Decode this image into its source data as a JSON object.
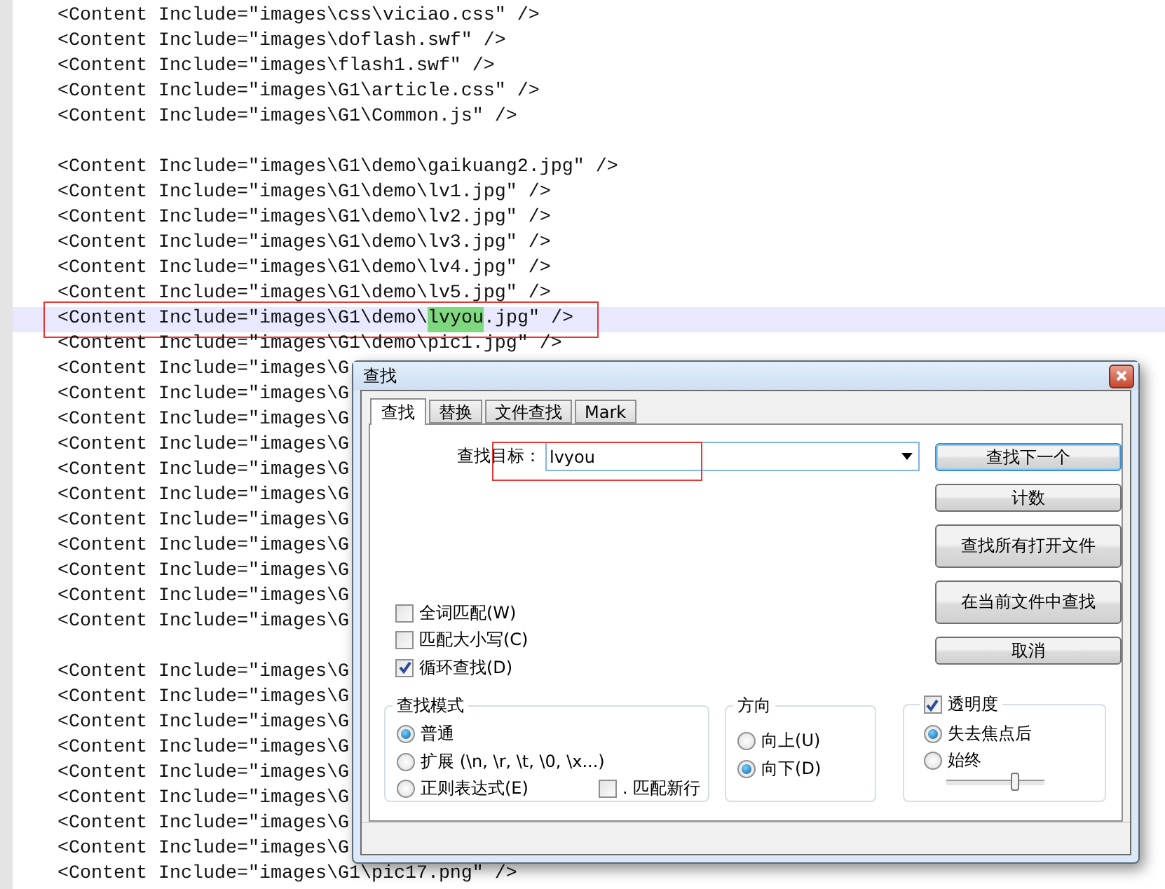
{
  "editor": {
    "lines": [
      {
        "kind": "plain",
        "text": "<Content Include=\"images\\css\\viciao.css\" />",
        "current": false,
        "boxed": false
      },
      {
        "kind": "plain",
        "text": "<Content Include=\"images\\doflash.swf\" />",
        "current": false,
        "boxed": false
      },
      {
        "kind": "plain",
        "text": "<Content Include=\"images\\flash1.swf\" />",
        "current": false,
        "boxed": false
      },
      {
        "kind": "plain",
        "text": "<Content Include=\"images\\G1\\article.css\" />",
        "current": false,
        "boxed": false
      },
      {
        "kind": "plain",
        "text": "<Content Include=\"images\\G1\\Common.js\" />",
        "current": false,
        "boxed": false
      },
      {
        "kind": "blank",
        "current": false,
        "boxed": false
      },
      {
        "kind": "plain",
        "text": "<Content Include=\"images\\G1\\demo\\gaikuang2.jpg\" />",
        "current": false,
        "boxed": false
      },
      {
        "kind": "plain",
        "text": "<Content Include=\"images\\G1\\demo\\lv1.jpg\" />",
        "current": false,
        "boxed": false
      },
      {
        "kind": "plain",
        "text": "<Content Include=\"images\\G1\\demo\\lv2.jpg\" />",
        "current": false,
        "boxed": false
      },
      {
        "kind": "plain",
        "text": "<Content Include=\"images\\G1\\demo\\lv3.jpg\" />",
        "current": false,
        "boxed": false
      },
      {
        "kind": "plain",
        "text": "<Content Include=\"images\\G1\\demo\\lv4.jpg\" />",
        "current": false,
        "boxed": false
      },
      {
        "kind": "plain",
        "text": "<Content Include=\"images\\G1\\demo\\lv5.jpg\" />",
        "current": false,
        "boxed": false
      },
      {
        "kind": "found",
        "before": "<Content Include=\"images\\G1\\demo\\",
        "match": "lvyou",
        "after": ".jpg\" />",
        "current": true,
        "boxed": true
      },
      {
        "kind": "plain",
        "text": "<Content Include=\"images\\G1\\demo\\pic1.jpg\" />",
        "current": false,
        "boxed": false
      },
      {
        "kind": "plain",
        "text": "<Content Include=\"images\\G",
        "current": false,
        "boxed": false
      },
      {
        "kind": "plain",
        "text": "<Content Include=\"images\\G",
        "current": false,
        "boxed": false
      },
      {
        "kind": "plain",
        "text": "<Content Include=\"images\\G",
        "current": false,
        "boxed": false
      },
      {
        "kind": "plain",
        "text": "<Content Include=\"images\\G",
        "current": false,
        "boxed": false
      },
      {
        "kind": "plain",
        "text": "<Content Include=\"images\\G",
        "current": false,
        "boxed": false
      },
      {
        "kind": "plain",
        "text": "<Content Include=\"images\\G",
        "current": false,
        "boxed": false
      },
      {
        "kind": "plain",
        "text": "<Content Include=\"images\\G",
        "current": false,
        "boxed": false
      },
      {
        "kind": "plain",
        "text": "<Content Include=\"images\\G",
        "current": false,
        "boxed": false
      },
      {
        "kind": "plain",
        "text": "<Content Include=\"images\\G",
        "current": false,
        "boxed": false
      },
      {
        "kind": "plain",
        "text": "<Content Include=\"images\\G",
        "current": false,
        "boxed": false
      },
      {
        "kind": "plain",
        "text": "<Content Include=\"images\\G",
        "current": false,
        "boxed": false
      },
      {
        "kind": "blank",
        "current": false,
        "boxed": false
      },
      {
        "kind": "plain",
        "text": "<Content Include=\"images\\G",
        "current": false,
        "boxed": false
      },
      {
        "kind": "plain",
        "text": "<Content Include=\"images\\G",
        "current": false,
        "boxed": false
      },
      {
        "kind": "plain",
        "text": "<Content Include=\"images\\G",
        "current": false,
        "boxed": false
      },
      {
        "kind": "plain",
        "text": "<Content Include=\"images\\G",
        "current": false,
        "boxed": false
      },
      {
        "kind": "plain",
        "text": "<Content Include=\"images\\G",
        "current": false,
        "boxed": false
      },
      {
        "kind": "plain",
        "text": "<Content Include=\"images\\G",
        "current": false,
        "boxed": false
      },
      {
        "kind": "plain",
        "text": "<Content Include=\"images\\G",
        "current": false,
        "boxed": false
      },
      {
        "kind": "plain",
        "text": "<Content Include=\"images\\G",
        "current": false,
        "boxed": false
      },
      {
        "kind": "plain",
        "text": "<Content Include=\"images\\G1\\pic17.png\" />",
        "current": false,
        "boxed": false
      }
    ]
  },
  "dialog": {
    "title": "查找",
    "tabs": [
      {
        "label": "查找",
        "selected": true
      },
      {
        "label": "替换",
        "selected": false
      },
      {
        "label": "文件查找",
        "selected": false
      },
      {
        "label": "Mark",
        "selected": false
      }
    ],
    "find": {
      "label": "查找目标：",
      "value": "lvyou",
      "boxed": true
    },
    "options": [
      {
        "label": "全词匹配(W)",
        "checked": false
      },
      {
        "label": "匹配大小写(C)",
        "checked": false
      },
      {
        "label": "循环查找(D)",
        "checked": true
      }
    ],
    "buttons": [
      {
        "label": "查找下一个",
        "focused": true,
        "kind": "short"
      },
      {
        "label": "计数",
        "focused": false,
        "kind": "short"
      },
      {
        "label": "查找所有打开文件",
        "focused": false,
        "kind": "tall"
      },
      {
        "label": "在当前文件中查找",
        "focused": false,
        "kind": "tall"
      },
      {
        "label": "取消",
        "focused": false,
        "kind": "short"
      }
    ],
    "mode_group": {
      "title": "查找模式",
      "options": [
        {
          "label": "普通",
          "selected": true
        },
        {
          "label": "扩展 (\\n, \\r, \\t, \\0, \\x...)",
          "selected": false
        },
        {
          "label": "正则表达式(E)",
          "selected": false
        }
      ],
      "newline": {
        "label": ". 匹配新行",
        "checked": false
      }
    },
    "direction_group": {
      "title": "方向",
      "options": [
        {
          "label": "向上(U)",
          "selected": false
        },
        {
          "label": "向下(D)",
          "selected": true
        }
      ]
    },
    "transparency_group": {
      "label": "透明度",
      "checked": true,
      "options": [
        {
          "label": "失去焦点后",
          "selected": true
        },
        {
          "label": "始终",
          "selected": false
        }
      ],
      "level": 0.7
    }
  }
}
